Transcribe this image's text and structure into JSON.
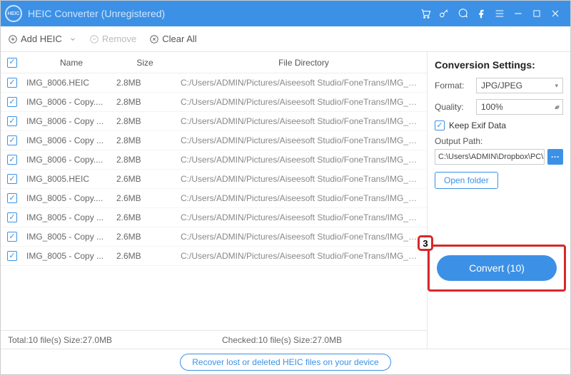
{
  "titlebar": {
    "title": "HEIC Converter (Unregistered)"
  },
  "toolbar": {
    "add_label": "Add HEIC",
    "remove_label": "Remove",
    "clear_label": "Clear All"
  },
  "columns": {
    "name": "Name",
    "size": "Size",
    "dir": "File Directory"
  },
  "files": [
    {
      "name": "IMG_8006.HEIC",
      "size": "2.8MB",
      "dir": "C:/Users/ADMIN/Pictures/Aiseesoft Studio/FoneTrans/IMG_80..."
    },
    {
      "name": "IMG_8006 - Copy....",
      "size": "2.8MB",
      "dir": "C:/Users/ADMIN/Pictures/Aiseesoft Studio/FoneTrans/IMG_80..."
    },
    {
      "name": "IMG_8006 - Copy ...",
      "size": "2.8MB",
      "dir": "C:/Users/ADMIN/Pictures/Aiseesoft Studio/FoneTrans/IMG_80..."
    },
    {
      "name": "IMG_8006 - Copy ...",
      "size": "2.8MB",
      "dir": "C:/Users/ADMIN/Pictures/Aiseesoft Studio/FoneTrans/IMG_80..."
    },
    {
      "name": "IMG_8006 - Copy....",
      "size": "2.8MB",
      "dir": "C:/Users/ADMIN/Pictures/Aiseesoft Studio/FoneTrans/IMG_80..."
    },
    {
      "name": "IMG_8005.HEIC",
      "size": "2.6MB",
      "dir": "C:/Users/ADMIN/Pictures/Aiseesoft Studio/FoneTrans/IMG_80..."
    },
    {
      "name": "IMG_8005 - Copy....",
      "size": "2.6MB",
      "dir": "C:/Users/ADMIN/Pictures/Aiseesoft Studio/FoneTrans/IMG_80..."
    },
    {
      "name": "IMG_8005 - Copy ...",
      "size": "2.6MB",
      "dir": "C:/Users/ADMIN/Pictures/Aiseesoft Studio/FoneTrans/IMG_80..."
    },
    {
      "name": "IMG_8005 - Copy ...",
      "size": "2.6MB",
      "dir": "C:/Users/ADMIN/Pictures/Aiseesoft Studio/FoneTrans/IMG_80..."
    },
    {
      "name": "IMG_8005 - Copy ...",
      "size": "2.6MB",
      "dir": "C:/Users/ADMIN/Pictures/Aiseesoft Studio/FoneTrans/IMG_80..."
    }
  ],
  "status": {
    "total": "Total:10 file(s) Size:27.0MB",
    "checked": "Checked:10 file(s) Size:27.0MB"
  },
  "settings": {
    "heading": "Conversion Settings:",
    "format_label": "Format:",
    "format_value": "JPG/JPEG",
    "quality_label": "Quality:",
    "quality_value": "100%",
    "keep_exif": "Keep Exif Data",
    "output_label": "Output Path:",
    "output_value": "C:\\Users\\ADMIN\\Dropbox\\PC\\",
    "browse": "···",
    "open_folder": "Open folder",
    "convert_label": "Convert (10)"
  },
  "callout": "3",
  "footer": {
    "recover": "Recover lost or deleted HEIC files on your device"
  }
}
